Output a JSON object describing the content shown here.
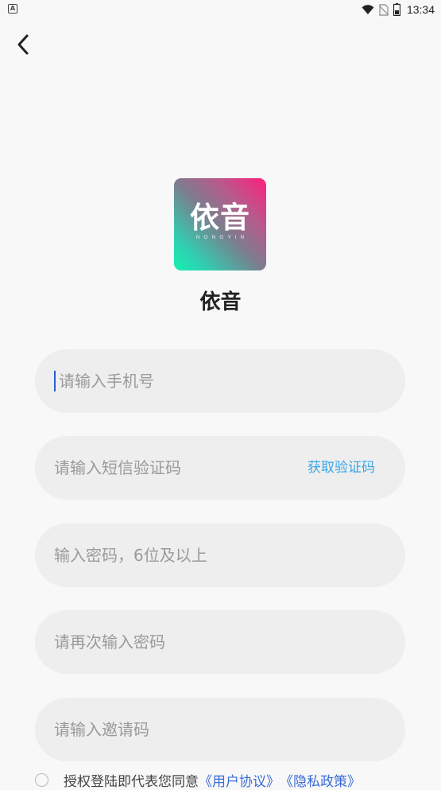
{
  "status_bar": {
    "left_icon": "app-notification-icon",
    "time": "13:34",
    "icons": [
      "wifi-icon",
      "no-sim-icon",
      "battery-icon"
    ]
  },
  "back_icon": "chevron-left-icon",
  "logo": {
    "title": "依音",
    "subtitle": "NONGYIN"
  },
  "app_name": "依音",
  "form": {
    "phone_placeholder": "请输入手机号",
    "sms_placeholder": "请输入短信验证码",
    "get_code_label": "获取验证码",
    "password_placeholder": "输入密码，6位及以上",
    "confirm_password_placeholder": "请再次输入密码",
    "invite_placeholder": "请输入邀请码"
  },
  "agreement": {
    "text": "授权登陆即代表您同意",
    "user_agreement": "《用户协议》",
    "privacy_policy": "《隐私政策》"
  },
  "colors": {
    "accent_link": "#3a6bd8",
    "code_button": "#3aa6e8",
    "field_bg": "#eeeeee",
    "cursor": "#2c5bd1"
  }
}
